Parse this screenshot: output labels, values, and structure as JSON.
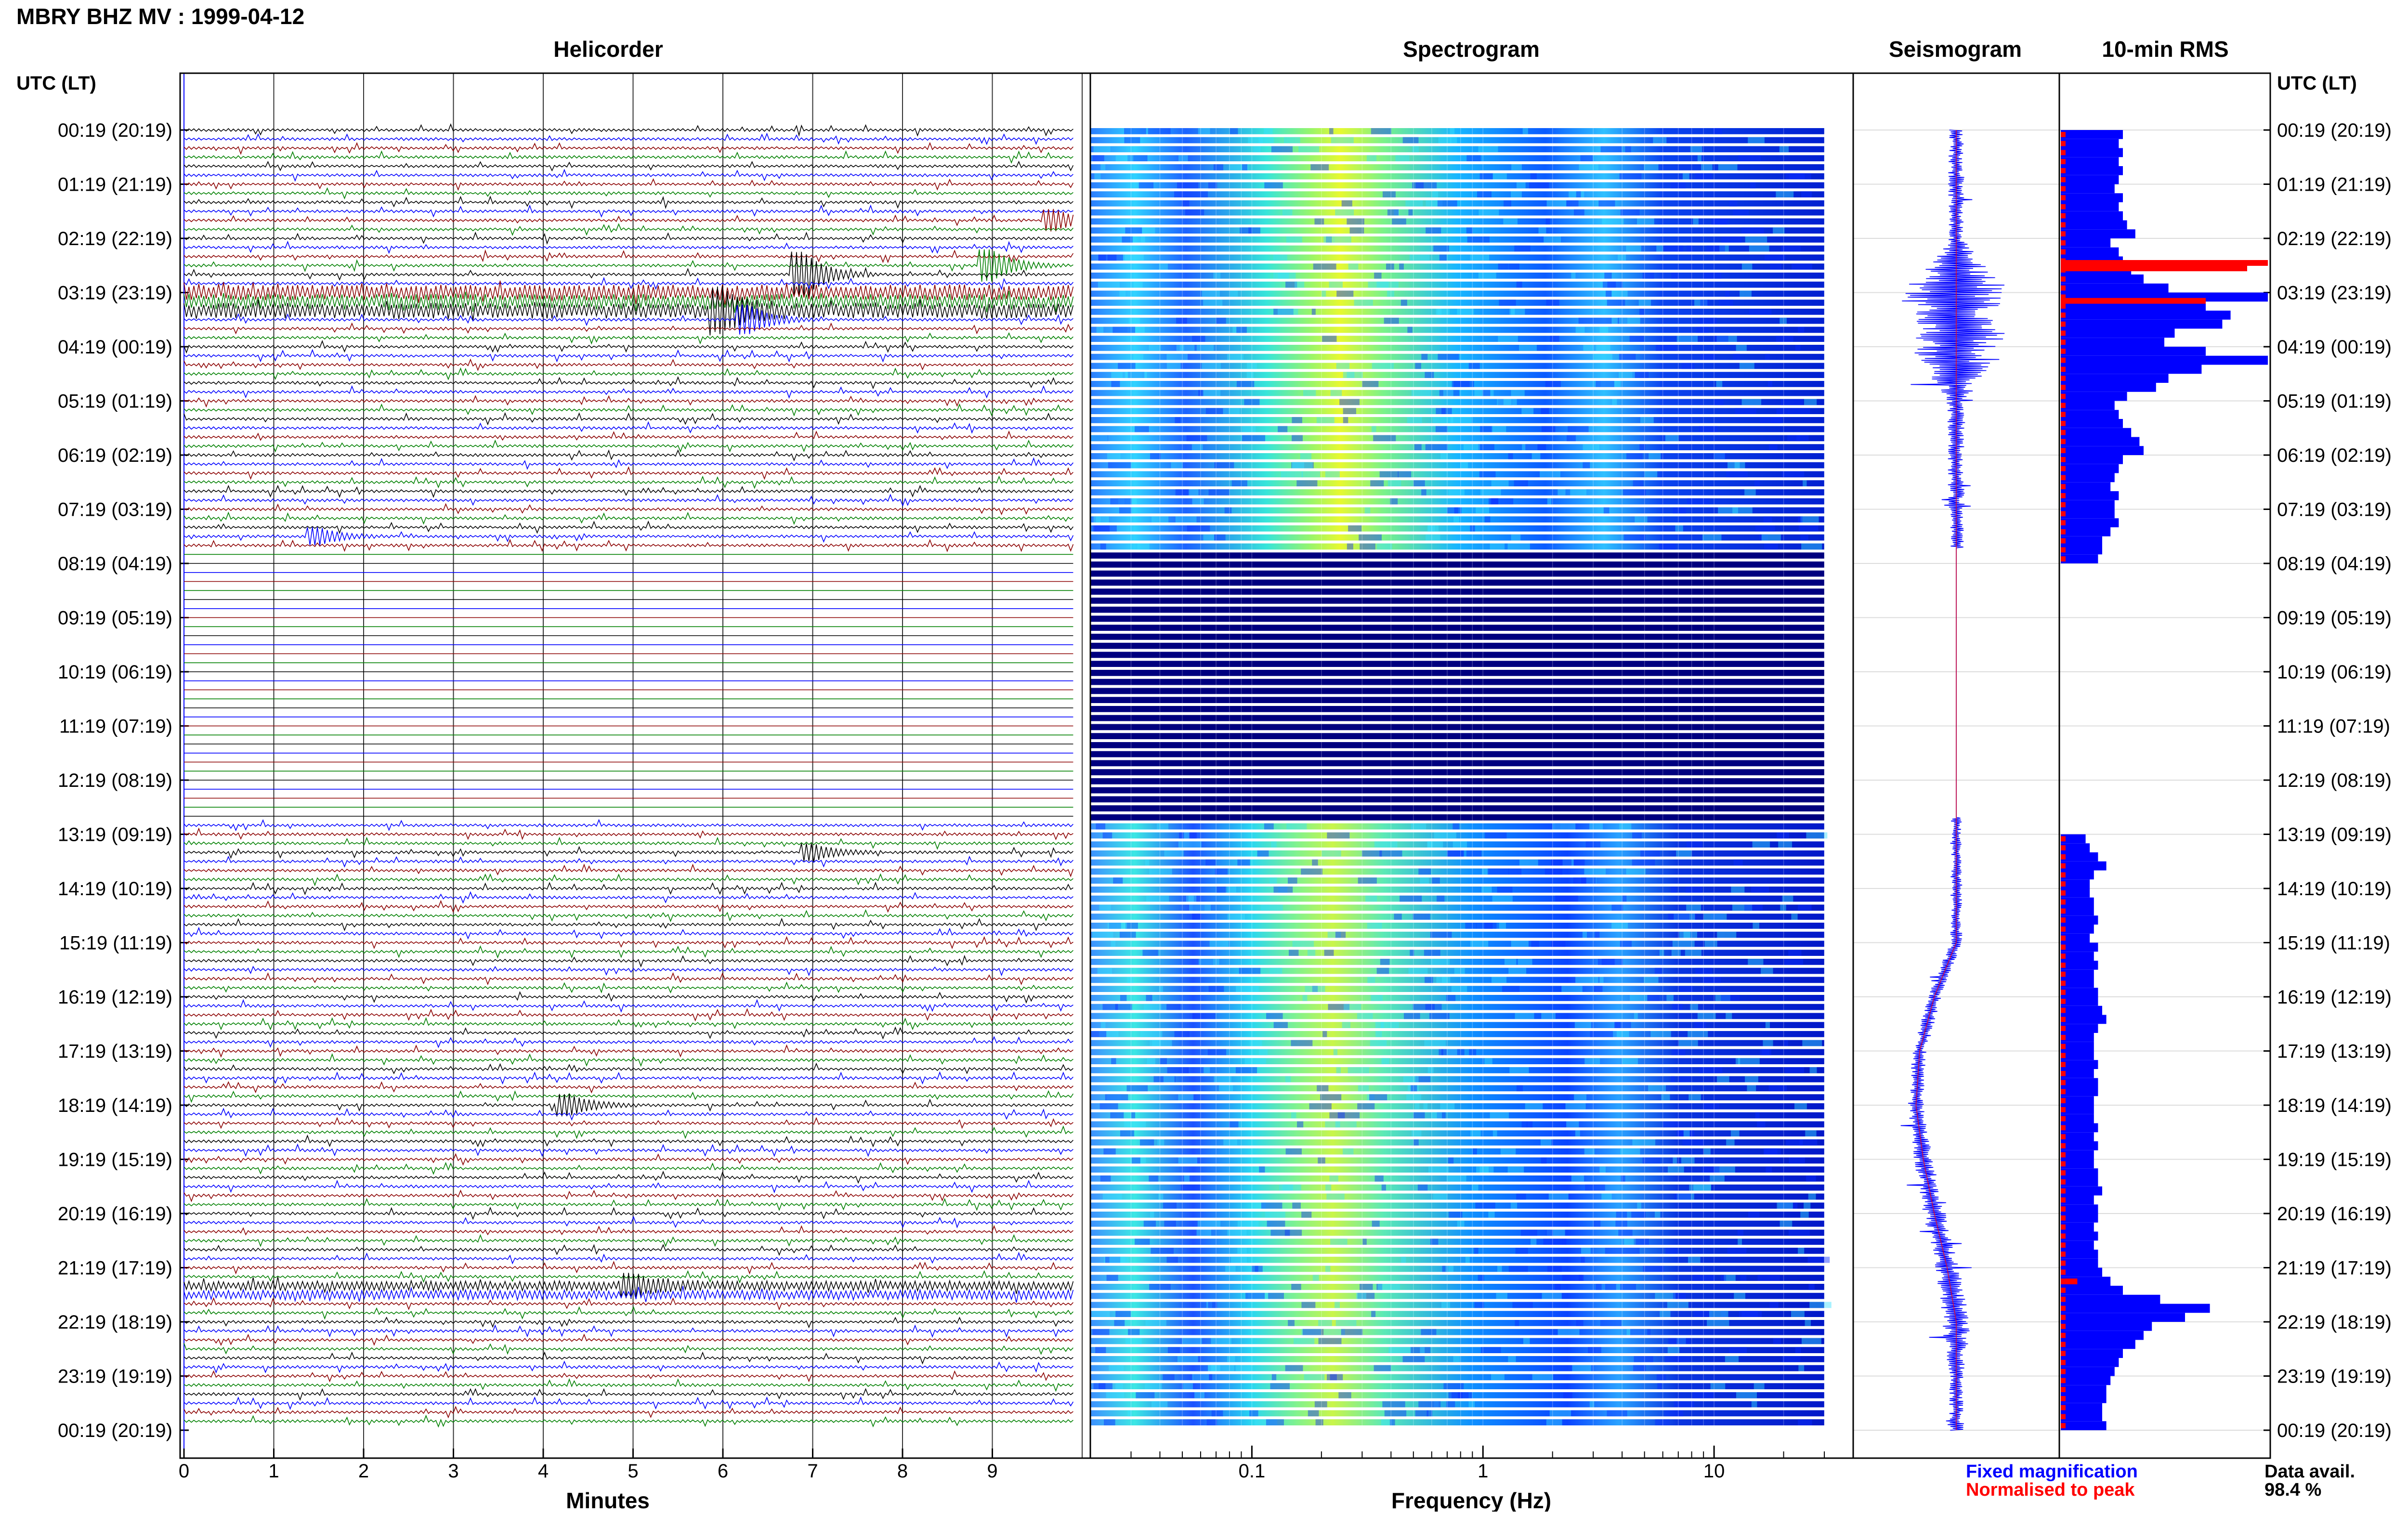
{
  "title": "MBRY BHZ MV : 1999-04-12",
  "panels": {
    "helicorder": "Helicorder",
    "spectrogram": "Spectrogram",
    "seismogram": "Seismogram",
    "rms": "10-min RMS"
  },
  "time_axis_label": "UTC (LT)",
  "time_labels": [
    "00:19 (20:19)",
    "01:19 (21:19)",
    "02:19 (22:19)",
    "03:19 (23:19)",
    "04:19 (00:19)",
    "05:19 (01:19)",
    "06:19 (02:19)",
    "07:19 (03:19)",
    "08:19 (04:19)",
    "09:19 (05:19)",
    "10:19 (06:19)",
    "11:19 (07:19)",
    "12:19 (08:19)",
    "13:19 (09:19)",
    "14:19 (10:19)",
    "15:19 (11:19)",
    "16:19 (12:19)",
    "17:19 (13:19)",
    "18:19 (14:19)",
    "19:19 (15:19)",
    "20:19 (16:19)",
    "21:19 (17:19)",
    "22:19 (18:19)",
    "23:19 (19:19)",
    "00:19 (20:19)"
  ],
  "legend": {
    "fixed": "Fixed magnification",
    "normalised": "Normalised to peak"
  },
  "data_avail": {
    "label": "Data avail.",
    "value": "98.4 %"
  },
  "colors": {
    "blue": "#0000ff",
    "red": "#ff0000",
    "dark_navy": "#00007f"
  },
  "chart_data": [
    {
      "type": "line",
      "title": "Helicorder",
      "xlabel": "Minutes",
      "x_ticks": [
        "0",
        "1",
        "2",
        "3",
        "4",
        "5",
        "6",
        "7",
        "8",
        "9"
      ],
      "xlim": [
        0,
        10
      ],
      "trace_colors": [
        "#000000",
        "#0000ff",
        "#8b0000",
        "#008000"
      ],
      "rows_per_hour": 6,
      "data_gap_hours": [
        7.7,
        12.7
      ],
      "events": [
        {
          "hour": 2.6,
          "minute": 6.9,
          "amplitude": 3.2,
          "color": "#008000"
        },
        {
          "hour": 2.5,
          "minute": 9.0,
          "amplitude": 2.2,
          "color": "#008000"
        },
        {
          "hour": 1.7,
          "minute": 9.7,
          "amplitude": 1.5,
          "color": "#00007f"
        },
        {
          "hour": 3.5,
          "minute": 6.3,
          "amplitude": 2.0,
          "color": "#8b0000"
        },
        {
          "hour": 3.3,
          "minute": 6.0,
          "amplitude": 2.6,
          "color": "#008000"
        },
        {
          "hour": 7.45,
          "minute": 1.5,
          "amplitude": 1.2,
          "color": "#8b0000"
        },
        {
          "hour": 13.4,
          "minute": 7.0,
          "amplitude": 1.2,
          "color": "#008000"
        },
        {
          "hour": 18.0,
          "minute": 4.3,
          "amplitude": 1.5,
          "color": "#000000"
        },
        {
          "hour": 21.4,
          "minute": 5.0,
          "amplitude": 1.4,
          "color": "#000000"
        }
      ]
    },
    {
      "type": "heatmap",
      "title": "Spectrogram",
      "xlabel": "Frequency (Hz)",
      "x_scale": "log",
      "x_ticks": [
        "0.1",
        "1",
        "10"
      ],
      "xlim": [
        0.02,
        40
      ],
      "data_gap_hours": [
        7.7,
        12.7
      ],
      "colormap": "jet",
      "band_peak_hz": 0.28
    },
    {
      "type": "line",
      "title": "Seismogram",
      "data_gap_hours": [
        7.7,
        12.7
      ],
      "envelope": [
        0.3,
        0.35,
        0.3,
        2.4,
        2.0,
        0.4,
        0.35,
        0.35,
        0.3,
        0.3,
        0.3,
        0.3,
        0.3,
        0.2,
        0.25,
        0.25,
        0.3,
        0.3,
        0.35,
        0.4,
        0.5,
        0.5,
        0.65,
        0.3,
        0.3
      ],
      "trend_offset": [
        0,
        0,
        0,
        0,
        0,
        0,
        0,
        0,
        0,
        0,
        0,
        0,
        0,
        0,
        0,
        0,
        -0.12,
        -0.2,
        -0.22,
        -0.18,
        -0.12,
        -0.05,
        0,
        0,
        0
      ]
    },
    {
      "type": "bar",
      "title": "10-min RMS",
      "orientation": "horizontal",
      "series": [
        {
          "legend_key": "fixed",
          "color": "#0000ff"
        },
        {
          "legend_key": "normalised",
          "color": "#ff0000"
        }
      ],
      "values_by_hour": [
        [
          0.3,
          0.28,
          0.3,
          0.28,
          0.3,
          0.28
        ],
        [
          0.26,
          0.3,
          0.28,
          0.3,
          0.32,
          0.36
        ],
        [
          0.24,
          0.28,
          0.3,
          0.34,
          0.4,
          0.52
        ],
        [
          1.0,
          0.7,
          0.82,
          0.78,
          0.55,
          0.5
        ],
        [
          0.7,
          1.0,
          0.68,
          0.52,
          0.46,
          0.32
        ],
        [
          0.26,
          0.28,
          0.3,
          0.34,
          0.38,
          0.4
        ],
        [
          0.3,
          0.28,
          0.26,
          0.24,
          0.28,
          0.26
        ],
        [
          0.26,
          0.28,
          0.24,
          0.2,
          0.2,
          0.18
        ],
        [
          0,
          0,
          0,
          0,
          0,
          0
        ],
        [
          0,
          0,
          0,
          0,
          0,
          0
        ],
        [
          0,
          0,
          0,
          0,
          0,
          0
        ],
        [
          0,
          0,
          0,
          0,
          0,
          0
        ],
        [
          0,
          0,
          0,
          0,
          0,
          0
        ],
        [
          0.12,
          0.14,
          0.18,
          0.22,
          0.16,
          0.14
        ],
        [
          0.14,
          0.16,
          0.16,
          0.18,
          0.16,
          0.14
        ],
        [
          0.18,
          0.16,
          0.18,
          0.16,
          0.16,
          0.18
        ],
        [
          0.18,
          0.2,
          0.22,
          0.18,
          0.16,
          0.16
        ],
        [
          0.16,
          0.18,
          0.16,
          0.18,
          0.18,
          0.16
        ],
        [
          0.16,
          0.16,
          0.18,
          0.16,
          0.18,
          0.16
        ],
        [
          0.16,
          0.18,
          0.18,
          0.2,
          0.16,
          0.18
        ],
        [
          0.18,
          0.16,
          0.18,
          0.16,
          0.18,
          0.18
        ],
        [
          0.2,
          0.24,
          0.3,
          0.48,
          0.72,
          0.6
        ],
        [
          0.44,
          0.4,
          0.36,
          0.3,
          0.28,
          0.26
        ],
        [
          0.24,
          0.22,
          0.22,
          0.2,
          0.2,
          0.22
        ]
      ],
      "normalised_peaks": [
        {
          "hour": 2.4,
          "value": 1.0
        },
        {
          "hour": 2.5,
          "value": 0.9
        },
        {
          "hour": 3.1,
          "value": 0.7
        },
        {
          "hour": 21.2,
          "value": 0.08
        }
      ]
    }
  ]
}
